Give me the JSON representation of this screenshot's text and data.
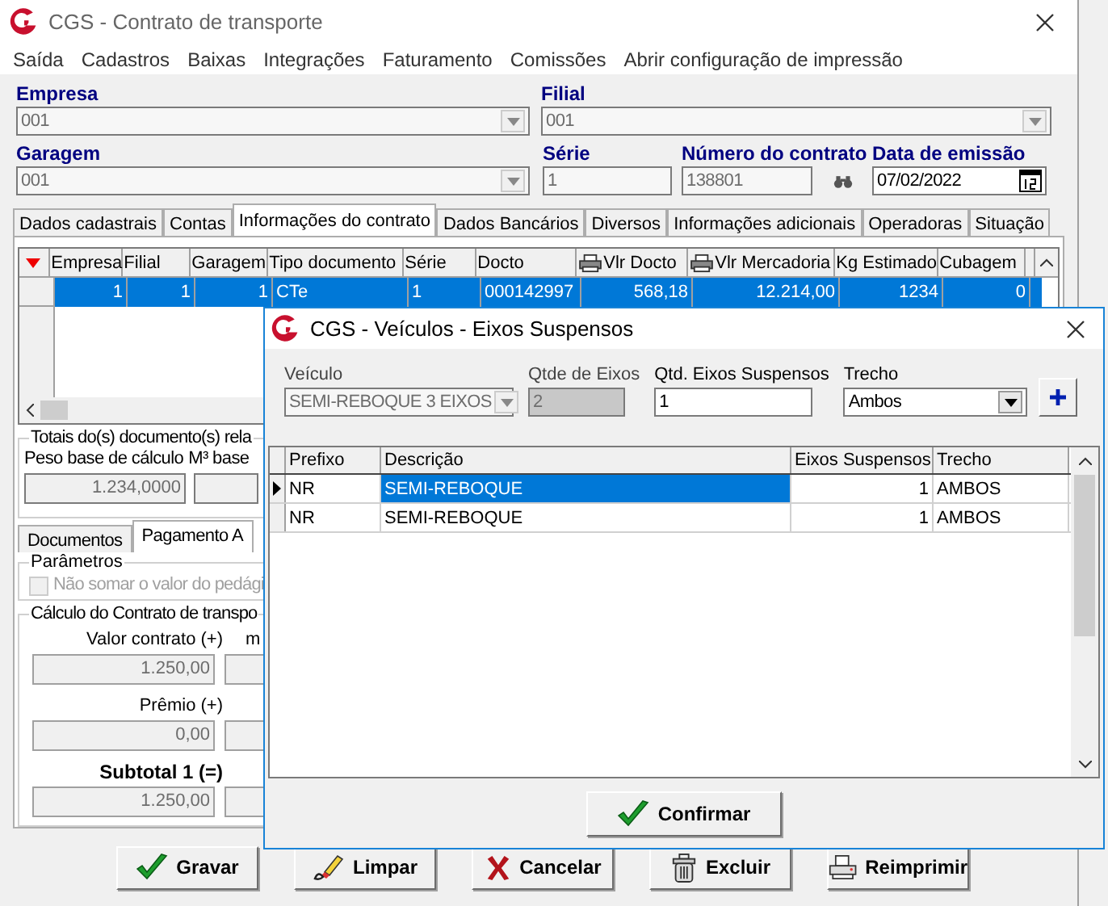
{
  "window": {
    "title": "CGS - Contrato de transporte"
  },
  "menu": [
    "Saída",
    "Cadastros",
    "Baixas",
    "Integrações",
    "Faturamento",
    "Comissões",
    "Abrir configuração de impressão"
  ],
  "header_rows": [
    [
      {
        "label": "Empresa",
        "value": "001",
        "kind": "combo",
        "disabled": true
      },
      {
        "label": "Filial",
        "value": "001",
        "kind": "combo",
        "disabled": true
      }
    ],
    [
      {
        "label": "Garagem",
        "value": "001",
        "kind": "combo",
        "disabled": true
      },
      {
        "label": "Série",
        "value": "1",
        "kind": "text",
        "disabled": true
      },
      {
        "label": "Número do contrato",
        "value": "138801",
        "kind": "search",
        "disabled": true
      },
      {
        "label": "Data de emissão",
        "value": "07/02/2022",
        "kind": "date",
        "disabled": false
      }
    ]
  ],
  "tabs": [
    {
      "label": "Dados cadastrais",
      "selected": false
    },
    {
      "label": "Contas",
      "selected": false
    },
    {
      "label": "Informações do contrato",
      "selected": true
    },
    {
      "label": "Dados Bancários",
      "selected": false
    },
    {
      "label": "Diversos",
      "selected": false
    },
    {
      "label": "Informações adicionais",
      "selected": false
    },
    {
      "label": "Operadoras",
      "selected": false
    },
    {
      "label": "Situação",
      "selected": false
    }
  ],
  "documents_grid": {
    "columns": [
      {
        "label": "Empresa",
        "kind": "text"
      },
      {
        "label": "Filial",
        "kind": "text"
      },
      {
        "label": "Garagem",
        "kind": "text"
      },
      {
        "label": "Tipo documento",
        "kind": "text"
      },
      {
        "label": "Série",
        "kind": "text"
      },
      {
        "label": "Docto",
        "kind": "text"
      },
      {
        "label": "Vlr Docto",
        "kind": "printer"
      },
      {
        "label": "Vlr Mercadoria",
        "kind": "printer"
      },
      {
        "label": "Kg Estimado",
        "kind": "text"
      },
      {
        "label": "Cubagem",
        "kind": "text"
      }
    ],
    "rows": [
      {
        "selected": true,
        "cells": [
          "1",
          "1",
          "1",
          "CTe",
          "1",
          "000142997",
          "568,18",
          "12.214,00",
          "1234",
          "0"
        ]
      }
    ]
  },
  "totals": {
    "legend": "Totais do(s) documento(s) rela",
    "labels": [
      "Peso base de cálculo",
      "M³ base"
    ],
    "value": "1.234,0000"
  },
  "sub_tabs": [
    {
      "label": "Documentos",
      "selected": false
    },
    {
      "label": "Pagamento A",
      "selected": true
    }
  ],
  "parameters": {
    "legend": "Parâmetros",
    "option": {
      "label": "Não somar o valor do pedági",
      "checked": false,
      "disabled": true
    }
  },
  "calculation": {
    "legend": "Cálculo do Contrato de transpo",
    "second_column_label": "m",
    "items": [
      {
        "label": "Valor contrato (+)",
        "value": "1.250,00",
        "bold": false
      },
      {
        "label": "Prêmio (+)",
        "value": "0,00",
        "bold": false
      },
      {
        "label": "Subtotal 1 (=)",
        "value": "1.250,00",
        "bold": true
      }
    ]
  },
  "actions": [
    {
      "label": "Gravar",
      "kind": "save"
    },
    {
      "label": "Limpar",
      "kind": "clear"
    },
    {
      "label": "Cancelar",
      "kind": "cancel"
    },
    {
      "label": "Excluir",
      "kind": "delete"
    },
    {
      "label": "Reimprimir",
      "kind": "print"
    }
  ],
  "dialog": {
    "title": "CGS - Veículos - Eixos Suspensos",
    "fields": [
      {
        "label": "Veículo",
        "value": "SEMI-REBOQUE 3 EIXOS",
        "kind": "combo",
        "disabled": true
      },
      {
        "label": "Qtde de Eixos",
        "value": "2",
        "kind": "text",
        "disabled": true
      },
      {
        "label": "Qtd. Eixos Suspensos",
        "value": "1",
        "kind": "text",
        "disabled": false
      },
      {
        "label": "Trecho",
        "value": "Ambos",
        "kind": "combo",
        "disabled": false
      }
    ],
    "grid": {
      "columns": [
        "Prefixo",
        "Descrição",
        "Eixos Suspensos",
        "Trecho"
      ],
      "rows": [
        {
          "current": true,
          "selected": true,
          "cells": [
            "NR",
            "SEMI-REBOQUE",
            "1",
            "AMBOS"
          ]
        },
        {
          "current": false,
          "selected": false,
          "cells": [
            "NR",
            "SEMI-REBOQUE",
            "1",
            "AMBOS"
          ]
        }
      ]
    },
    "confirm": "Confirmar"
  }
}
